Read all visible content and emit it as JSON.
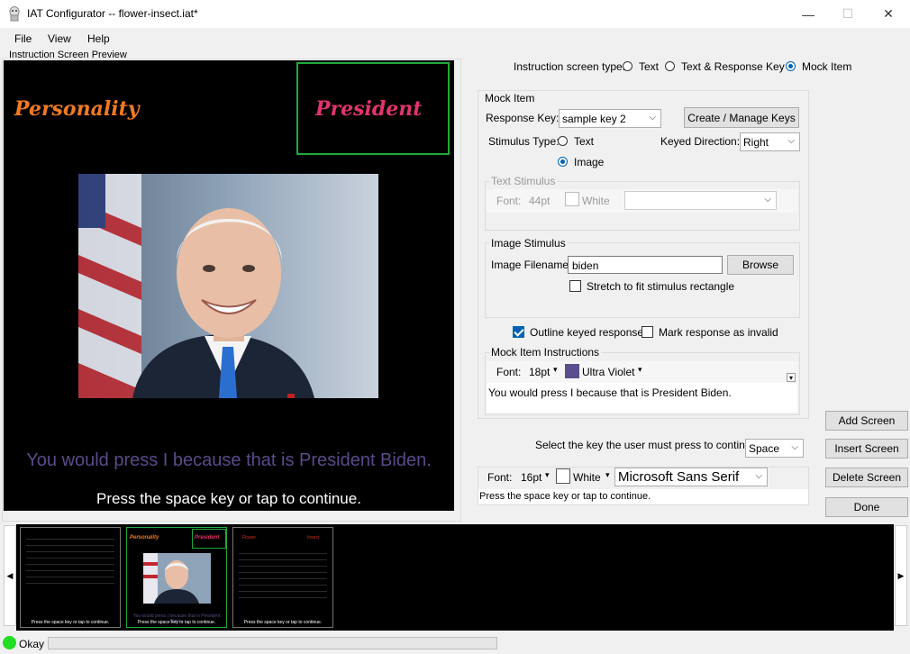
{
  "window": {
    "title": "IAT Configurator -- flower-insect.iat*",
    "minimize": "—",
    "maximize": "☐",
    "close": "✕"
  },
  "menu": {
    "file": "File",
    "view": "View",
    "help": "Help"
  },
  "preview": {
    "caption": "Instruction Screen Preview",
    "left_label": "Personality",
    "right_label": "President",
    "instruction": "You would press I because that is President Biden.",
    "continue": "Press the space key or tap to continue.",
    "colors": {
      "left_label": "#f07a22",
      "right_label": "#e0356a",
      "instruction": "#5a4a8a",
      "outline": "#1faa3a"
    }
  },
  "screen_type": {
    "label": "Instruction screen type:",
    "options": [
      "Text",
      "Text & Response Key",
      "Mock Item"
    ],
    "selected": "Mock Item"
  },
  "mock_item": {
    "title": "Mock Item",
    "response_key_label": "Response Key:",
    "response_key_value": "sample key 2",
    "manage_keys_button": "Create / Manage Keys",
    "stimulus_type_label": "Stimulus Type:",
    "stimulus_text": "Text",
    "stimulus_image": "Image",
    "stimulus_selected": "Image",
    "keyed_direction_label": "Keyed Direction:",
    "keyed_direction_value": "Right"
  },
  "text_stimulus": {
    "title": "Text Stimulus",
    "font_label": "Font:",
    "size": "44pt",
    "color": "White",
    "font_name": ""
  },
  "image_stimulus": {
    "title": "Image Stimulus",
    "filename_label": "Image Filename:",
    "filename_value": "biden",
    "browse_button": "Browse",
    "stretch_label": "Stretch to fit stimulus rectangle",
    "stretch_checked": false
  },
  "outline": {
    "outline_label": "Outline keyed response",
    "outline_checked": true,
    "invalid_label": "Mark response as invalid",
    "invalid_checked": false
  },
  "instructions": {
    "title": "Mock Item Instructions",
    "font_label": "Font:",
    "size": "18pt",
    "color_name": "Ultra Violet",
    "color": "#5a4f8c",
    "text": "You would press I because that is President Biden."
  },
  "continue_key": {
    "label": "Select the key the user must press to continue:",
    "value": "Space"
  },
  "continue_font": {
    "font_label": "Font:",
    "size": "16pt",
    "color": "White",
    "font_name": "Microsoft Sans Serif",
    "text": "Press the space key or tap to continue."
  },
  "side_buttons": {
    "add": "Add Screen",
    "insert": "Insert Screen",
    "delete": "Delete Screen",
    "done": "Done"
  },
  "thumbnails": [
    {
      "continue": "Press the space key or tap to continue."
    },
    {
      "left": "Personality",
      "right": "President",
      "instruction": "You would press I because that is President Biden.",
      "continue": "Press the space key or tap to continue."
    },
    {
      "left": "Flower",
      "right": "Insect",
      "continue": "Press the space key or tap to continue."
    }
  ],
  "status": {
    "text": "Okay",
    "color": "#22dd22"
  }
}
